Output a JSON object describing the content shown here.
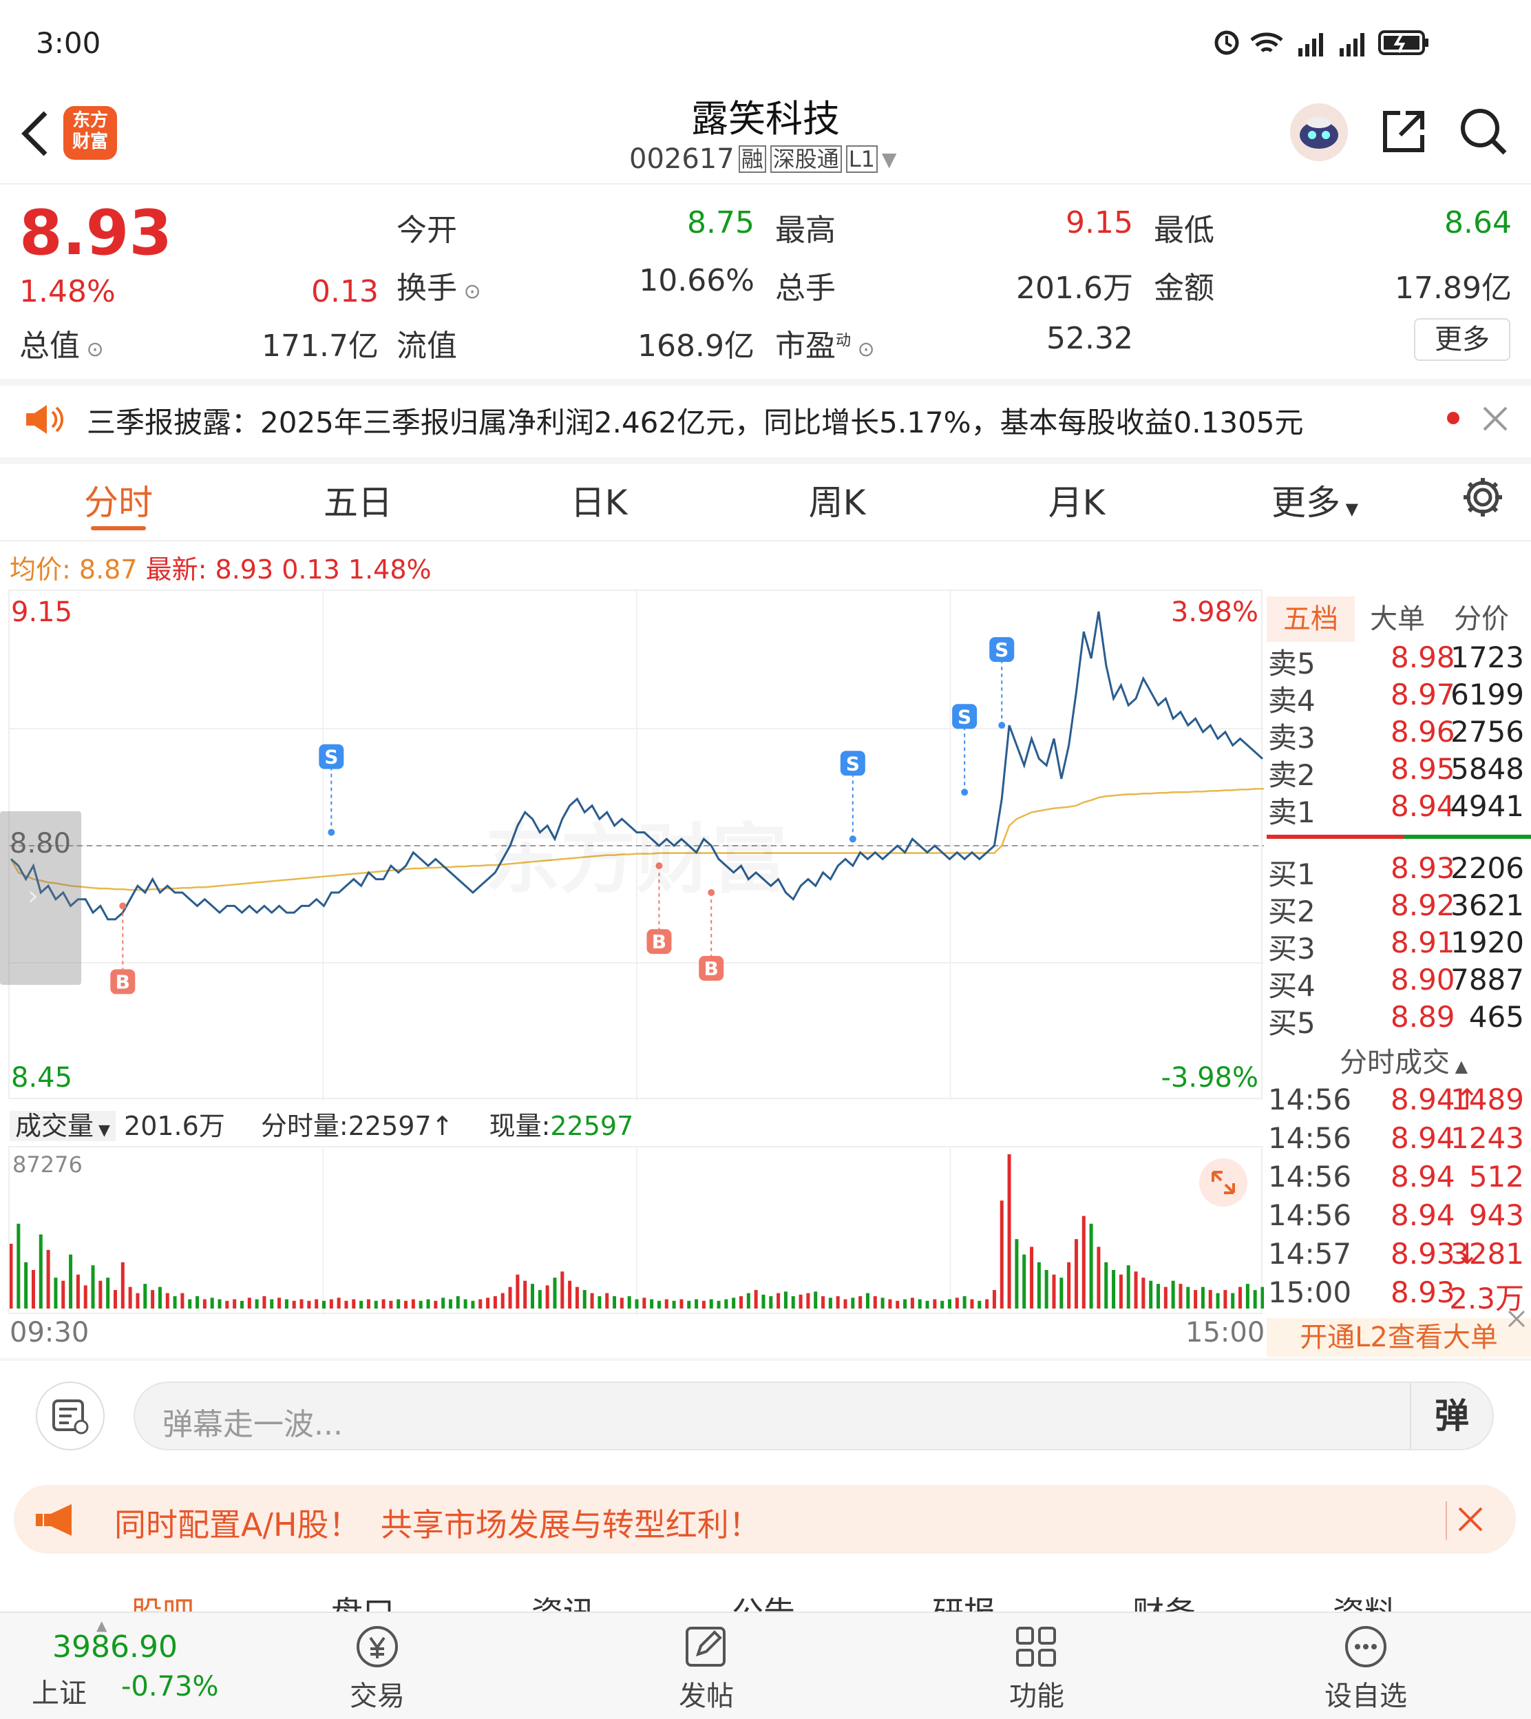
{
  "status_bar": {
    "time": "3:00"
  },
  "header": {
    "title": "露笑科技",
    "code": "002617",
    "badges": [
      "融",
      "深股通",
      "L1"
    ],
    "logo_line1": "东方",
    "logo_line2": "财富"
  },
  "quote": {
    "price": "8.93",
    "change_pct": "1.48%",
    "change": "0.13",
    "open_label": "今开",
    "open": "8.75",
    "high_label": "最高",
    "high": "9.15",
    "low_label": "最低",
    "low": "8.64",
    "turnover_label": "换手",
    "turnover": "10.66%",
    "volume_label": "总手",
    "volume": "201.6万",
    "amount_label": "金额",
    "amount": "17.89亿",
    "mktcap_label": "总值",
    "mktcap": "171.7亿",
    "float_label": "流值",
    "float_cap": "168.9亿",
    "pe_label": "市盈",
    "pe_sup": "动",
    "pe": "52.32",
    "more": "更多"
  },
  "notice": {
    "text": "三季报披露：2025年三季报归属净利润2.462亿元，同比增长5.17%，基本每股收益0.1305元"
  },
  "tabs": [
    "分时",
    "五日",
    "日K",
    "周K",
    "月K",
    "更多"
  ],
  "chart_header": {
    "avg_label": "均价:",
    "avg": "8.87",
    "latest_label": "最新:",
    "latest": "8.93",
    "chg": "0.13",
    "chg_pct": "1.48%"
  },
  "chart_labels": {
    "top_price": "9.15",
    "top_pct": "3.98%",
    "mid_price": "8.80",
    "bottom_price": "8.45",
    "bottom_pct": "-3.98%",
    "vol_max": "87276",
    "t_start": "09:30",
    "t_end": "15:00",
    "watermark": "东方财富"
  },
  "volume_bar": {
    "label": "成交量",
    "total": "201.6万",
    "min_label": "分时量:",
    "min_vol": "22597↑",
    "cur_label": "现量:",
    "cur_vol": "22597"
  },
  "chart_data": {
    "type": "line",
    "ylim": [
      8.45,
      9.15
    ],
    "xlim": [
      "09:30",
      "15:00"
    ],
    "price": [
      8.78,
      8.77,
      8.75,
      8.77,
      8.73,
      8.74,
      8.72,
      8.73,
      8.71,
      8.72,
      8.72,
      8.7,
      8.71,
      8.69,
      8.69,
      8.7,
      8.72,
      8.74,
      8.73,
      8.75,
      8.73,
      8.74,
      8.73,
      8.73,
      8.72,
      8.71,
      8.72,
      8.71,
      8.7,
      8.71,
      8.71,
      8.7,
      8.71,
      8.7,
      8.71,
      8.7,
      8.71,
      8.7,
      8.7,
      8.71,
      8.71,
      8.72,
      8.71,
      8.73,
      8.73,
      8.74,
      8.75,
      8.74,
      8.76,
      8.75,
      8.75,
      8.77,
      8.76,
      8.77,
      8.79,
      8.78,
      8.77,
      8.78,
      8.77,
      8.76,
      8.75,
      8.74,
      8.73,
      8.74,
      8.75,
      8.76,
      8.78,
      8.8,
      8.83,
      8.85,
      8.84,
      8.82,
      8.83,
      8.81,
      8.84,
      8.86,
      8.87,
      8.85,
      8.86,
      8.84,
      8.85,
      8.83,
      8.84,
      8.83,
      8.82,
      8.82,
      8.81,
      8.8,
      8.81,
      8.8,
      8.81,
      8.8,
      8.79,
      8.81,
      8.8,
      8.78,
      8.77,
      8.76,
      8.77,
      8.75,
      8.76,
      8.75,
      8.74,
      8.75,
      8.73,
      8.72,
      8.74,
      8.75,
      8.74,
      8.76,
      8.75,
      8.77,
      8.78,
      8.77,
      8.79,
      8.78,
      8.79,
      8.78,
      8.79,
      8.8,
      8.79,
      8.81,
      8.8,
      8.79,
      8.8,
      8.79,
      8.78,
      8.79,
      8.78,
      8.79,
      8.78,
      8.79,
      8.8,
      8.87,
      8.98,
      8.95,
      8.92,
      8.96,
      8.93,
      8.92,
      8.96,
      8.9,
      8.95,
      9.03,
      9.12,
      9.08,
      9.15,
      9.07,
      9.02,
      9.04,
      9.01,
      9.02,
      9.05,
      9.03,
      9.01,
      9.02,
      8.99,
      9.0,
      8.98,
      8.99,
      8.97,
      8.98,
      8.96,
      8.97,
      8.95,
      8.96,
      8.95,
      8.94,
      8.93
    ],
    "avg_price": [
      8.78,
      8.76,
      8.755,
      8.75,
      8.748,
      8.745,
      8.744,
      8.742,
      8.74,
      8.739,
      8.738,
      8.737,
      8.736,
      8.736,
      8.735,
      8.735,
      8.734,
      8.734,
      8.734,
      8.735,
      8.735,
      8.736,
      8.736,
      8.737,
      8.737,
      8.738,
      8.738,
      8.739,
      8.74,
      8.741,
      8.742,
      8.743,
      8.744,
      8.745,
      8.746,
      8.747,
      8.748,
      8.749,
      8.75,
      8.751,
      8.752,
      8.753,
      8.754,
      8.755,
      8.756,
      8.757,
      8.758,
      8.759,
      8.76,
      8.761,
      8.762,
      8.763,
      8.764,
      8.765,
      8.766,
      8.766,
      8.767,
      8.767,
      8.768,
      8.768,
      8.769,
      8.769,
      8.77,
      8.77,
      8.771,
      8.771,
      8.772,
      8.773,
      8.774,
      8.775,
      8.776,
      8.777,
      8.778,
      8.779,
      8.78,
      8.781,
      8.782,
      8.783,
      8.784,
      8.785,
      8.786,
      8.786,
      8.787,
      8.787,
      8.788,
      8.788,
      8.788,
      8.789,
      8.789,
      8.789,
      8.789,
      8.789,
      8.789,
      8.789,
      8.789,
      8.789,
      8.789,
      8.789,
      8.789,
      8.789,
      8.789,
      8.789,
      8.789,
      8.789,
      8.789,
      8.789,
      8.789,
      8.789,
      8.789,
      8.789,
      8.789,
      8.789,
      8.789,
      8.789,
      8.789,
      8.789,
      8.789,
      8.789,
      8.789,
      8.789,
      8.789,
      8.789,
      8.789,
      8.789,
      8.789,
      8.789,
      8.789,
      8.789,
      8.789,
      8.789,
      8.789,
      8.789,
      8.789,
      8.8,
      8.83,
      8.84,
      8.845,
      8.85,
      8.852,
      8.854,
      8.856,
      8.857,
      8.858,
      8.86,
      8.865,
      8.868,
      8.872,
      8.874,
      8.875,
      8.876,
      8.877,
      8.877,
      8.878,
      8.878,
      8.879,
      8.879,
      8.88,
      8.88,
      8.88,
      8.881,
      8.881,
      8.882,
      8.882,
      8.883,
      8.883,
      8.884,
      8.884,
      8.885,
      8.885,
      8.885
    ],
    "volume": [
      42,
      55,
      30,
      25,
      48,
      38,
      20,
      18,
      35,
      22,
      15,
      28,
      18,
      20,
      12,
      30,
      14,
      10,
      16,
      12,
      14,
      10,
      8,
      10,
      6,
      8,
      6,
      7,
      6,
      5,
      6,
      5,
      7,
      6,
      8,
      6,
      7,
      6,
      5,
      6,
      5,
      6,
      5,
      6,
      7,
      5,
      6,
      5,
      6,
      5,
      6,
      5,
      6,
      5,
      6,
      5,
      6,
      5,
      7,
      6,
      8,
      6,
      5,
      6,
      7,
      8,
      10,
      14,
      22,
      18,
      16,
      12,
      15,
      20,
      24,
      18,
      14,
      12,
      10,
      8,
      10,
      8,
      7,
      8,
      6,
      7,
      6,
      5,
      6,
      5,
      6,
      5,
      6,
      5,
      6,
      5,
      6,
      7,
      8,
      10,
      12,
      9,
      8,
      10,
      11,
      8,
      9,
      10,
      11,
      8,
      7,
      8,
      6,
      7,
      8,
      10,
      8,
      7,
      6,
      5,
      6,
      7,
      6,
      5,
      6,
      5,
      6,
      7,
      8,
      6,
      5,
      6,
      12,
      70,
      100,
      45,
      35,
      40,
      30,
      25,
      22,
      20,
      30,
      45,
      60,
      55,
      40,
      30,
      25,
      22,
      28,
      24,
      20,
      18,
      16,
      14,
      18,
      16,
      14,
      12,
      14,
      12,
      10,
      12,
      10,
      14,
      16,
      12,
      14,
      10,
      12,
      18,
      20,
      24
    ],
    "signals": [
      {
        "type": "B",
        "price": 8.71
      },
      {
        "type": "S",
        "price": 8.82
      },
      {
        "type": "B",
        "price": 8.77
      },
      {
        "type": "B",
        "price": 8.73
      },
      {
        "type": "S",
        "price": 8.81
      },
      {
        "type": "S",
        "price": 8.88
      },
      {
        "type": "S",
        "price": 8.98
      }
    ]
  },
  "orderbook": {
    "tabs": [
      "五档",
      "大单",
      "分价"
    ],
    "sells": [
      {
        "label": "卖5",
        "price": "8.98",
        "vol": "1723"
      },
      {
        "label": "卖4",
        "price": "8.97",
        "vol": "6199"
      },
      {
        "label": "卖3",
        "price": "8.96",
        "vol": "2756"
      },
      {
        "label": "卖2",
        "price": "8.95",
        "vol": "5848"
      },
      {
        "label": "卖1",
        "price": "8.94",
        "vol": "4941"
      }
    ],
    "buys": [
      {
        "label": "买1",
        "price": "8.93",
        "vol": "2206"
      },
      {
        "label": "买2",
        "price": "8.92",
        "vol": "3621"
      },
      {
        "label": "买3",
        "price": "8.91",
        "vol": "1920"
      },
      {
        "label": "买4",
        "price": "8.90",
        "vol": "7887"
      },
      {
        "label": "买5",
        "price": "8.89",
        "vol": "465"
      }
    ],
    "ticks_title": "分时成交",
    "ticks": [
      {
        "t": "14:56",
        "p": "8.94↑",
        "v": "1489"
      },
      {
        "t": "14:56",
        "p": "8.94",
        "v": "1243"
      },
      {
        "t": "14:56",
        "p": "8.94",
        "v": "512"
      },
      {
        "t": "14:56",
        "p": "8.94",
        "v": "943"
      },
      {
        "t": "14:57",
        "p": "8.93↓",
        "v": "3281"
      },
      {
        "t": "15:00",
        "p": "8.93",
        "v": "2.3万"
      }
    ],
    "l2": "开通L2查看大单"
  },
  "danmu": {
    "placeholder": "弹幕走一波...",
    "send": "弹"
  },
  "promo": {
    "text": "同时配置A/H股！  共享市场发展与转型红利！"
  },
  "section_tabs": [
    "股吧",
    "盘口",
    "资讯",
    "公告",
    "研报",
    "财务",
    "资料"
  ],
  "bottom_nav": {
    "index_value": "3986.90",
    "index_name": "上证",
    "index_pct": "-0.73%",
    "items": [
      "交易",
      "发帖",
      "功能",
      "设自选"
    ]
  }
}
